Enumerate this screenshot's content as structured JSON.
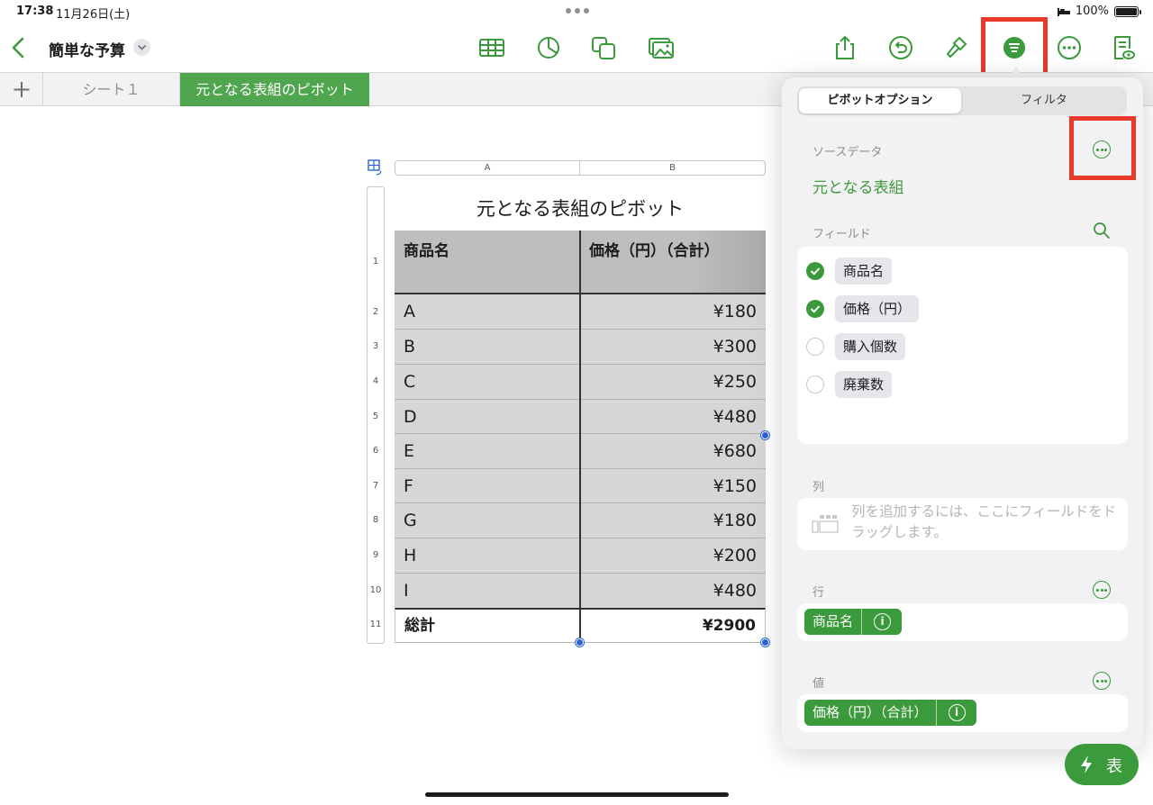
{
  "status": {
    "time": "17:38",
    "date": "11月26日(土)",
    "battery": "100%"
  },
  "toolbar": {
    "title": "簡単な予算"
  },
  "tabs": {
    "sheet1": "シート１",
    "active": "元となる表組のピボット"
  },
  "table": {
    "columns": [
      "A",
      "B"
    ],
    "title": "元となる表組のピボット",
    "header": [
      "商品名",
      "価格（円）（合計）"
    ],
    "rows": [
      {
        "num": "2",
        "name": "A",
        "value": "¥180"
      },
      {
        "num": "3",
        "name": "B",
        "value": "¥300"
      },
      {
        "num": "4",
        "name": "C",
        "value": "¥250"
      },
      {
        "num": "5",
        "name": "D",
        "value": "¥480"
      },
      {
        "num": "6",
        "name": "E",
        "value": "¥680"
      },
      {
        "num": "7",
        "name": "F",
        "value": "¥150"
      },
      {
        "num": "8",
        "name": "G",
        "value": "¥180"
      },
      {
        "num": "9",
        "name": "H",
        "value": "¥200"
      },
      {
        "num": "10",
        "name": "I",
        "value": "¥480"
      }
    ],
    "total": {
      "num": "11",
      "name": "総計",
      "value": "¥2900"
    },
    "header_row_num": "1"
  },
  "panel": {
    "segments": {
      "options": "ピボットオプション",
      "filter": "フィルタ"
    },
    "source_label": "ソースデータ",
    "source_value": "元となる表組",
    "fields_label": "フィールド",
    "fields": [
      {
        "name": "商品名",
        "checked": true
      },
      {
        "name": "価格（円）",
        "checked": true
      },
      {
        "name": "購入個数",
        "checked": false
      },
      {
        "name": "廃棄数",
        "checked": false
      }
    ],
    "columns_label": "列",
    "columns_hint": "列を追加するには、ここにフィールドをドラッグします。",
    "rows_label": "行",
    "rows_chip": "商品名",
    "values_label": "値",
    "values_chip": "価格（円）（合計）",
    "info_glyph": "i"
  },
  "fab": {
    "label": "表"
  },
  "colors": {
    "accent": "#3b9a3b",
    "highlight": "#e8392b"
  }
}
